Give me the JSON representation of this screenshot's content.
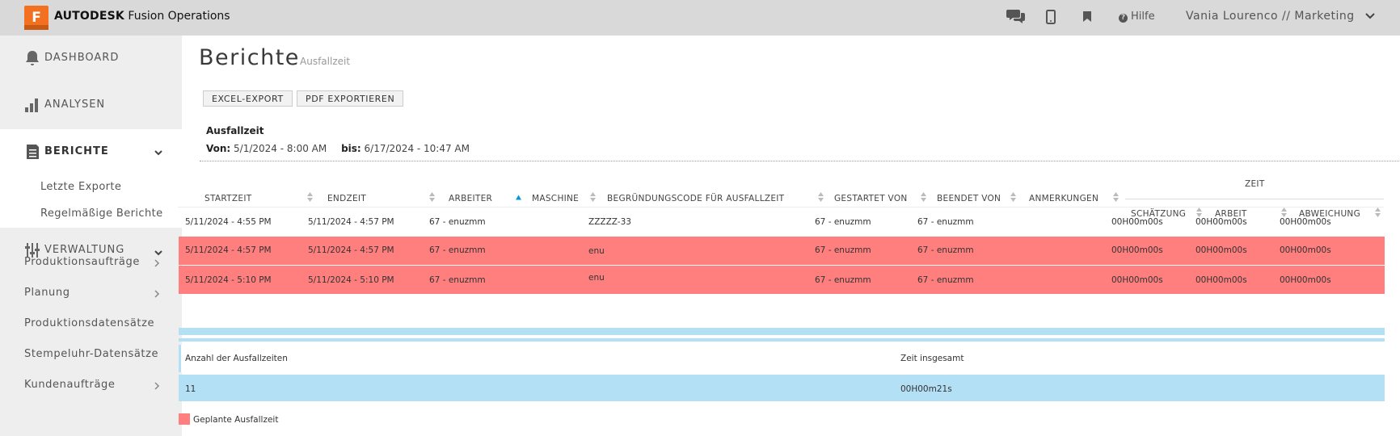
{
  "topbar": {
    "logo_letter": "F",
    "brand_bold": "AUTODESK",
    "brand_rest": " Fusion Operations",
    "help_label": "Hilfe",
    "user_label": "Vania Lourenco // Marketing"
  },
  "sidebar": {
    "main": [
      {
        "label": "DASHBOARD"
      },
      {
        "label": "ANALYSEN"
      },
      {
        "label": "BERICHTE"
      },
      {
        "label": "VERWALTUNG"
      }
    ],
    "reports_sub": [
      "Letzte Exporte",
      "Regelmäßige Berichte"
    ],
    "sections": [
      "Produktionsaufträge",
      "Planung",
      "Produktionsdatensätze",
      "Stempeluhr-Datensätze",
      "Kundenaufträge"
    ]
  },
  "page": {
    "title": "Berichte",
    "subtitle": "Ausfallzeit",
    "buttons": {
      "excel": "EXCEL-EXPORT",
      "pdf": "PDF EXPORTIEREN"
    },
    "report_title": "Ausfallzeit",
    "range": {
      "from_label": "Von:",
      "from": "5/1/2024 - 8:00 AM",
      "to_label": "bis:",
      "to": "6/17/2024 - 10:47 AM"
    }
  },
  "table": {
    "headers": {
      "start": "STARTZEIT",
      "end": "ENDZEIT",
      "worker": "ARBEITER",
      "machine": "MASCHINE",
      "reason": "BEGRÜNDUNGSCODE FÜR AUSFALLZEIT",
      "started_by": "GESTARTET VON",
      "ended_by": "BEENDET VON",
      "notes": "ANMERKUNGEN",
      "zeit": "ZEIT",
      "estimate": "SCHÄTZUNG",
      "work": "ARBEIT",
      "deviation": "ABWEICHUNG"
    },
    "rows": [
      {
        "start": "5/11/2024 - 4:55 PM",
        "end": "5/11/2024 - 4:57 PM",
        "worker": "67 - enuzmm",
        "machine": "",
        "reason": "ZZZZZ-33",
        "started_by": "67 - enuzmm",
        "ended_by": "67 - enuzmm",
        "notes": "",
        "estimate": "00H00m00s",
        "work": "00H00m00s",
        "deviation": "00H00m00s",
        "planned": false
      },
      {
        "start": "5/11/2024 - 4:57 PM",
        "end": "5/11/2024 - 4:57 PM",
        "worker": "67 - enuzmm",
        "machine": "",
        "reason": "enu",
        "started_by": "67 - enuzmm",
        "ended_by": "67 - enuzmm",
        "notes": "",
        "estimate": "00H00m00s",
        "work": "00H00m00s",
        "deviation": "00H00m00s",
        "planned": true
      },
      {
        "start": "5/11/2024 - 5:10 PM",
        "end": "5/11/2024 - 5:10 PM",
        "worker": "67 - enuzmm",
        "machine": "",
        "reason": "enu",
        "started_by": "67 - enuzmm",
        "ended_by": "67 - enuzmm",
        "notes": "",
        "estimate": "00H00m00s",
        "work": "00H00m00s",
        "deviation": "00H00m00s",
        "planned": true
      }
    ]
  },
  "summary": {
    "count_label": "Anzahl der Ausfallzeiten",
    "total_label": "Zeit insgesamt",
    "count": "11",
    "total": "00H00m21s"
  },
  "legend": {
    "planned_label": "Geplante Ausfallzeit"
  },
  "colors": {
    "accent_orange": "#f37021",
    "planned_red": "#ff7f7f",
    "summary_blue": "#b3e0f5",
    "sort_active": "#0696d7"
  }
}
